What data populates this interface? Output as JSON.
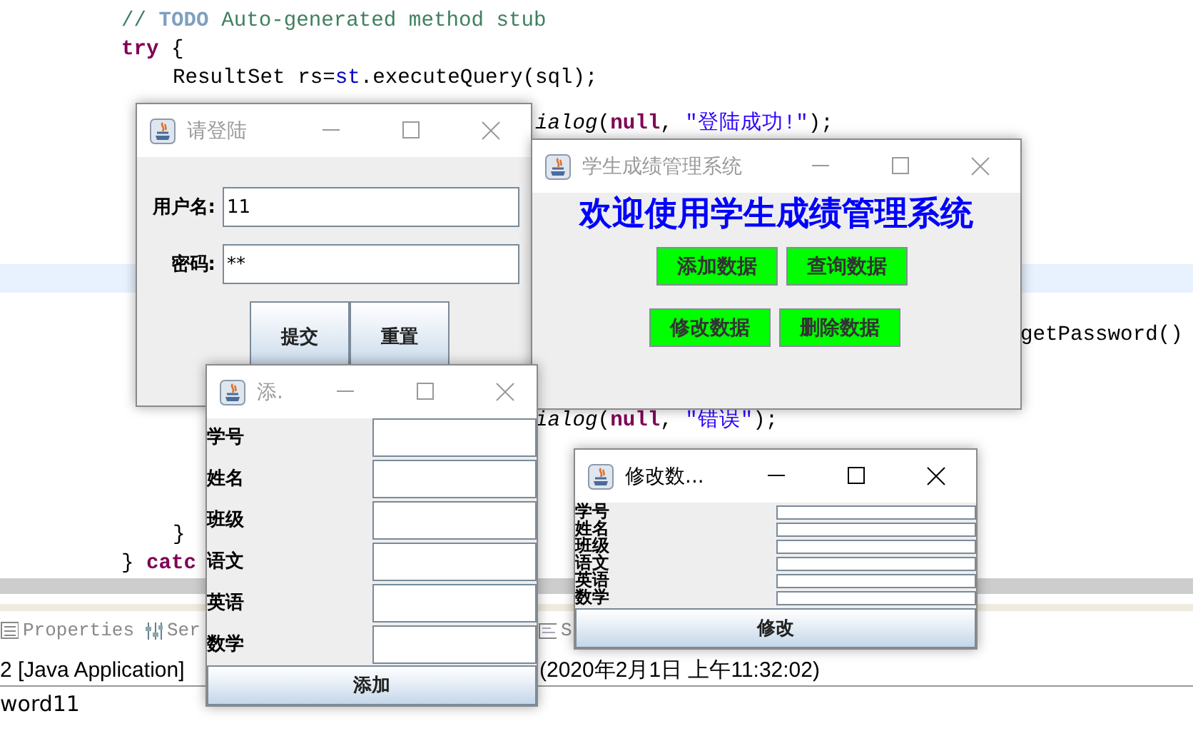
{
  "editor": {
    "lines": [
      {
        "tokens": [
          {
            "text": "// ",
            "kind": "comment"
          },
          {
            "text": "TODO",
            "kind": "task"
          },
          {
            "text": " Auto-generated method stub",
            "kind": "comment"
          }
        ]
      },
      {
        "tokens": [
          {
            "text": "try",
            "kind": "keyword"
          },
          {
            "text": " {",
            "kind": "plain"
          }
        ]
      },
      {
        "tokens": [
          {
            "text": "ResultSet rs=",
            "kind": "plain"
          },
          {
            "text": "st",
            "kind": "field"
          },
          {
            "text": ".executeQuery(sql);",
            "kind": "plain"
          }
        ]
      },
      {
        "tokens": [
          {
            "text": "ialog",
            "kind": "method"
          },
          {
            "text": "(",
            "kind": "plain"
          },
          {
            "text": "null",
            "kind": "keyword"
          },
          {
            "text": ", ",
            "kind": "plain"
          },
          {
            "text": "\"登陆成功!\"",
            "kind": "string"
          },
          {
            "text": ");",
            "kind": "plain"
          }
        ]
      },
      {
        "tokens": [
          {
            "text": "getPassword()",
            "kind": "plain"
          }
        ]
      },
      {
        "tokens": [
          {
            "text": "ialog",
            "kind": "method"
          },
          {
            "text": "(",
            "kind": "plain"
          },
          {
            "text": "null",
            "kind": "keyword"
          },
          {
            "text": ", ",
            "kind": "plain"
          },
          {
            "text": "\"错误\"",
            "kind": "string"
          },
          {
            "text": ");",
            "kind": "plain"
          }
        ]
      },
      {
        "tokens": [
          {
            "text": "}",
            "kind": "plain"
          }
        ]
      },
      {
        "tokens": [
          {
            "text": "} ",
            "kind": "plain"
          },
          {
            "text": "catc",
            "kind": "keyword"
          }
        ]
      }
    ]
  },
  "login_window": {
    "title": "请登陆",
    "active": false,
    "fields": [
      {
        "label": "用户名:",
        "value": "11"
      },
      {
        "label": "密码:",
        "value": "**"
      }
    ],
    "buttons": [
      "提交",
      "重置"
    ]
  },
  "main_window": {
    "title": "学生成绩管理系统",
    "active": false,
    "heading": "欢迎使用学生成绩管理系统",
    "buttons": [
      "添加数据",
      "查询数据",
      "修改数据",
      "删除数据"
    ]
  },
  "add_window": {
    "title": "添.",
    "active": false,
    "fields": [
      {
        "label": "学号"
      },
      {
        "label": "姓名"
      },
      {
        "label": "班级"
      },
      {
        "label": "语文"
      },
      {
        "label": "英语"
      },
      {
        "label": "数学"
      }
    ],
    "button": "添加"
  },
  "modify_window": {
    "title": "修改数...",
    "active": true,
    "fields": [
      {
        "label": "学号"
      },
      {
        "label": "姓名"
      },
      {
        "label": "班级"
      },
      {
        "label": "语文"
      },
      {
        "label": "英语"
      },
      {
        "label": "数学"
      }
    ],
    "button": "修改"
  },
  "bottom_panel": {
    "tabs": [
      {
        "label": "Properties",
        "selected": false
      },
      {
        "label": "Ser",
        "selected": false
      },
      {
        "label": "S",
        "selected": false
      }
    ],
    "console": {
      "header": "2 [Java Application]",
      "timestamp": "(2020年2月1日 上午11:32:02)",
      "output": "word11"
    }
  }
}
